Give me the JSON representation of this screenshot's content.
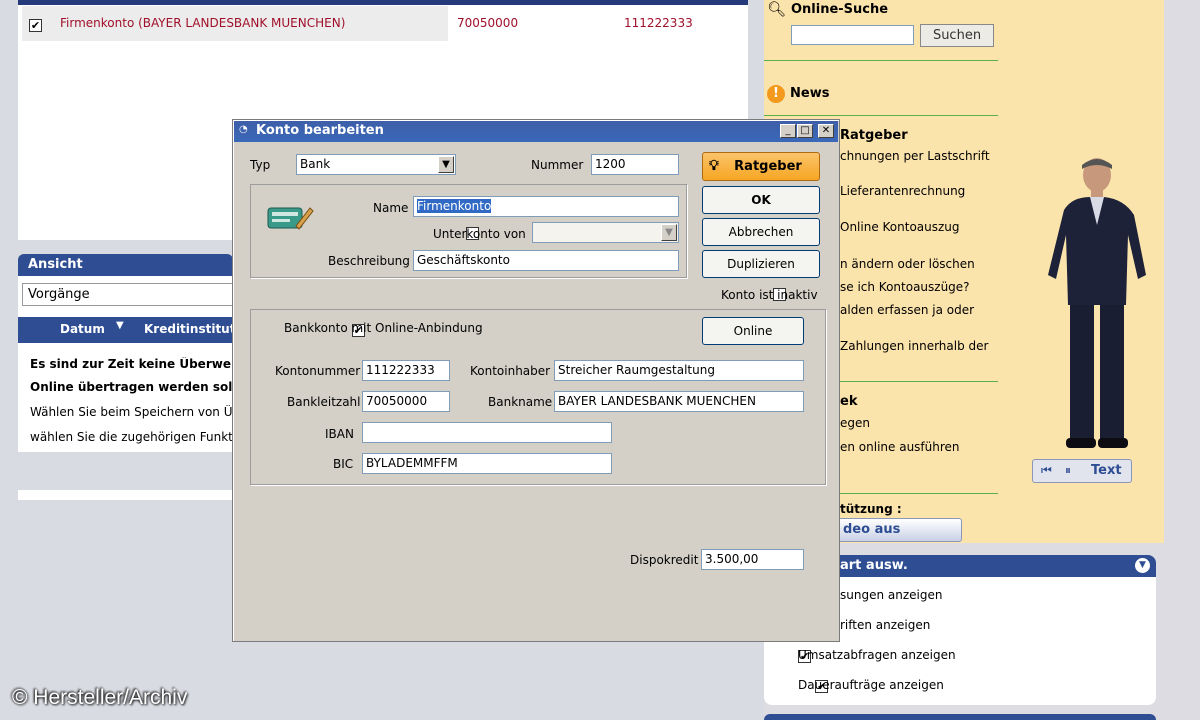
{
  "account_list": {
    "row": {
      "name": "Firmenkonto (BAYER LANDESBANK MUENCHEN)",
      "blz": "70050000",
      "number": "111222333"
    }
  },
  "ansicht": {
    "title": "Ansicht",
    "select_value": "Vorgänge",
    "col_datum": "Datum",
    "col_kredit": "Kreditinstitut",
    "msg1": "Es sind zur Zeit keine Überweis",
    "msg2": "Online übertragen werden soll",
    "msg3": "Wählen Sie beim Speichern von Übe",
    "msg4": "wählen Sie die zugehörigen Funktio"
  },
  "sidebar": {
    "search_title": "Online-Suche",
    "search_button": "Suchen",
    "news": "News",
    "ratgeber_title": "Ratgeber",
    "items": [
      "chnungen per Lastschrift",
      "Lieferantenrechnung",
      "Online Kontoauszug",
      "n ändern oder löschen",
      "se ich Kontoauszüge?",
      "alden erfassen ja oder",
      "Zahlungen innerhalb der"
    ],
    "section2_title": "ek",
    "section2_items": [
      "egen",
      "en online ausführen"
    ],
    "support": "tützung :",
    "video_button": "deo aus",
    "player_text": "Text",
    "panel2_title": "art ausw.",
    "options": [
      {
        "label": "sungen anzeigen",
        "checked": false
      },
      {
        "label": "riften anzeigen",
        "checked": false
      },
      {
        "label": "Umsatzabfragen anzeigen",
        "checked": true
      },
      {
        "label": "Daueraufträge anzeigen",
        "checked": true
      }
    ]
  },
  "dialog": {
    "title": "Konto bearbeiten",
    "typ_label": "Typ",
    "typ_value": "Bank",
    "nummer_label": "Nummer",
    "nummer_value": "1200",
    "name_label": "Name",
    "name_value": "Firmenkonto",
    "unterkonto_label": "Unterkonto von",
    "beschreibung_label": "Beschreibung",
    "beschreibung_value": "Geschäftskonto",
    "ratgeber_button": "Ratgeber",
    "ok_button": "OK",
    "abbrechen_button": "Abbrechen",
    "duplizieren_button": "Duplizieren",
    "inaktiv_label": "Konto ist inaktiv",
    "online_label": "Bankkonto mit Online-Anbindung",
    "online_button": "Online",
    "kontonummer_label": "Kontonummer",
    "kontonummer_value": "111222333",
    "kontoinhaber_label": "Kontoinhaber",
    "kontoinhaber_value": "Streicher Raumgestaltung",
    "blz_label": "Bankleitzahl",
    "blz_value": "70050000",
    "bankname_label": "Bankname",
    "bankname_value": "BAYER LANDESBANK MUENCHEN",
    "iban_label": "IBAN",
    "iban_value": "",
    "bic_label": "BIC",
    "bic_value": "BYLADEMMFFM",
    "dispo_label": "Dispokredit",
    "dispo_value": "3.500,00"
  },
  "watermark": "© Hersteller/Archiv",
  "colors": {
    "accent_blue": "#2f4d93",
    "sidebar_bg": "#fbe3ac",
    "ratgeber_orange": "#f6a623"
  }
}
